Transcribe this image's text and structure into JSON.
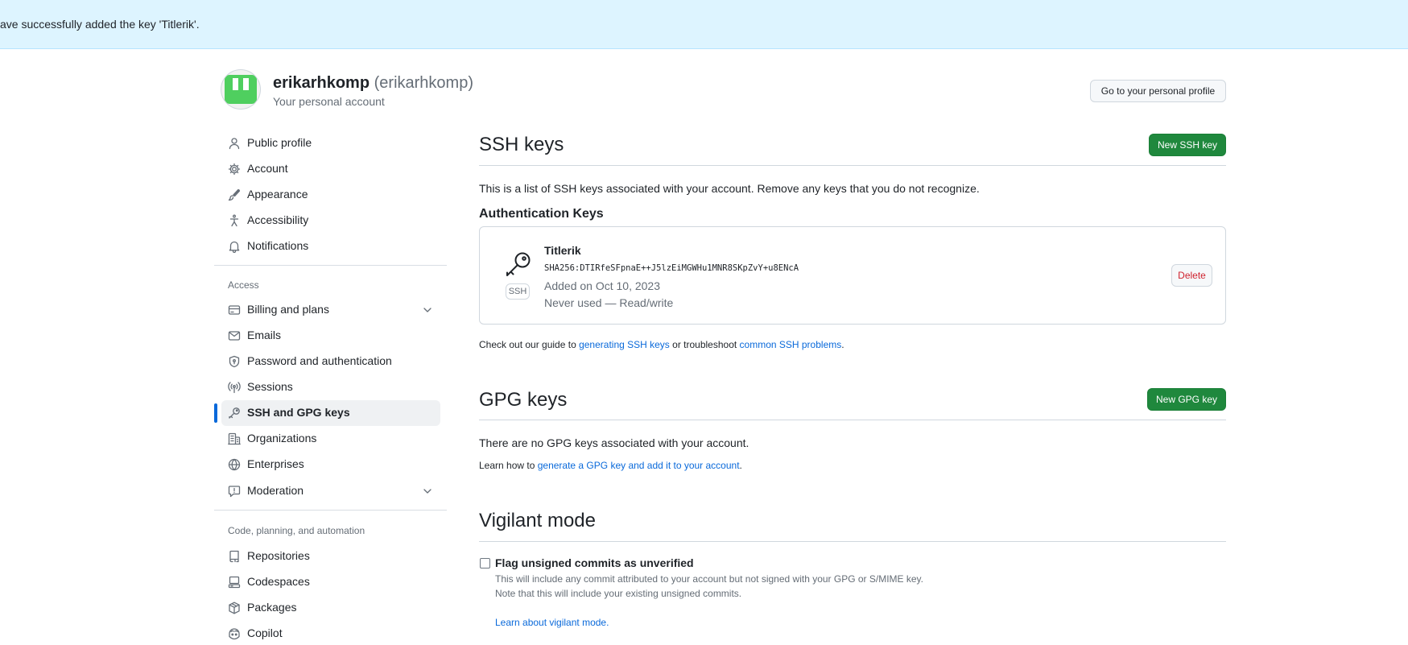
{
  "flash": {
    "message": "ave successfully added the key 'Titlerik'."
  },
  "account": {
    "name": "erikarhkomp",
    "handle": "(erikarhkomp)",
    "subtitle": "Your personal account",
    "profile_button": "Go to your personal profile"
  },
  "sidebar": {
    "items": [
      {
        "label": "Public profile",
        "icon": "person-icon"
      },
      {
        "label": "Account",
        "icon": "gear-icon"
      },
      {
        "label": "Appearance",
        "icon": "paintbrush-icon"
      },
      {
        "label": "Accessibility",
        "icon": "accessibility-icon"
      },
      {
        "label": "Notifications",
        "icon": "bell-icon"
      }
    ],
    "access_heading": "Access",
    "access_items": [
      {
        "label": "Billing and plans",
        "icon": "credit-card-icon",
        "expandable": true
      },
      {
        "label": "Emails",
        "icon": "mail-icon"
      },
      {
        "label": "Password and authentication",
        "icon": "shield-lock-icon"
      },
      {
        "label": "Sessions",
        "icon": "broadcast-icon"
      },
      {
        "label": "SSH and GPG keys",
        "icon": "key-icon",
        "active": true
      },
      {
        "label": "Organizations",
        "icon": "organization-icon"
      },
      {
        "label": "Enterprises",
        "icon": "globe-icon"
      },
      {
        "label": "Moderation",
        "icon": "report-icon",
        "expandable": true
      }
    ],
    "code_heading": "Code, planning, and automation",
    "code_items": [
      {
        "label": "Repositories",
        "icon": "repo-icon"
      },
      {
        "label": "Codespaces",
        "icon": "codespaces-icon"
      },
      {
        "label": "Packages",
        "icon": "package-icon"
      },
      {
        "label": "Copilot",
        "icon": "copilot-icon"
      }
    ]
  },
  "ssh": {
    "title": "SSH keys",
    "new_button": "New SSH key",
    "description": "This is a list of SSH keys associated with your account. Remove any keys that you do not recognize.",
    "auth_heading": "Authentication Keys",
    "key": {
      "title": "Titlerik",
      "fingerprint": "SHA256:DTIRfeSFpnaE++J5lzEiMGWHu1MNR8SKpZvY+u8ENcA",
      "type": "SSH",
      "added": "Added on Oct 10, 2023",
      "usage": "Never used — Read/write",
      "delete_label": "Delete"
    },
    "guide_prefix": "Check out our guide to ",
    "guide_link1": "generating SSH keys",
    "guide_mid": " or troubleshoot ",
    "guide_link2": "common SSH problems",
    "guide_suffix": "."
  },
  "gpg": {
    "title": "GPG keys",
    "new_button": "New GPG key",
    "empty_text": "There are no GPG keys associated with your account.",
    "learn_prefix": "Learn how to ",
    "learn_link": "generate a GPG key and add it to your account",
    "learn_suffix": "."
  },
  "vigilant": {
    "title": "Vigilant mode",
    "checkbox_label": "Flag unsigned commits as unverified",
    "checked": false,
    "note1": "This will include any commit attributed to your account but not signed with your GPG or S/MIME key.",
    "note2": "Note that this will include your existing unsigned commits.",
    "learn_link": "Learn about vigilant mode."
  }
}
